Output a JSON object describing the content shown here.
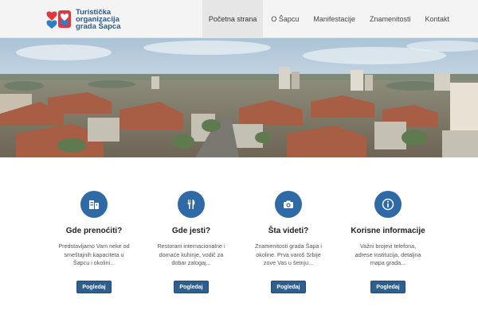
{
  "logo": {
    "line1": "Turistička",
    "line2": "organizacija",
    "line3": "grada Šapca"
  },
  "nav": {
    "items": [
      {
        "label": "Početna strana",
        "active": true
      },
      {
        "label": "O Šapcu",
        "active": false
      },
      {
        "label": "Manifestacije",
        "active": false
      },
      {
        "label": "Znamenitosti",
        "active": false
      },
      {
        "label": "Kontakt",
        "active": false
      }
    ]
  },
  "features": [
    {
      "icon": "building-icon",
      "title": "Gde prenoćiti?",
      "desc1": "Predstavljamo Vam neke od",
      "desc2": "smeštajnih kapaciteta u",
      "desc3": "Šapcu i okolini...",
      "button": "Pogledaj"
    },
    {
      "icon": "fork-knife-icon",
      "title": "Gde jesti?",
      "desc1": "Restorani internacionalne i",
      "desc2": "domaće kuhinje, vodič za",
      "desc3": "dobar zalogaj...",
      "button": "Pogledaj"
    },
    {
      "icon": "camera-icon",
      "title": "Šta videti?",
      "desc1": "Znamenitosti grada Šapa i",
      "desc2": "okoline. Prva varoš Srbije",
      "desc3": "zove Vas u šetnju...",
      "button": "Pogledaj"
    },
    {
      "icon": "info-icon",
      "title": "Korisne informacije",
      "desc1": "Važni brojevi telefona,",
      "desc2": "adrese institucija, detaljna",
      "desc3": "mapa grada...",
      "button": "Pogledaj"
    }
  ],
  "colors": {
    "accent": "#2f6aa6",
    "button": "#2f5f8f",
    "header_bg": "#f4f4f4",
    "logo_red": "#e0383e",
    "logo_blue": "#2a7fc9"
  }
}
